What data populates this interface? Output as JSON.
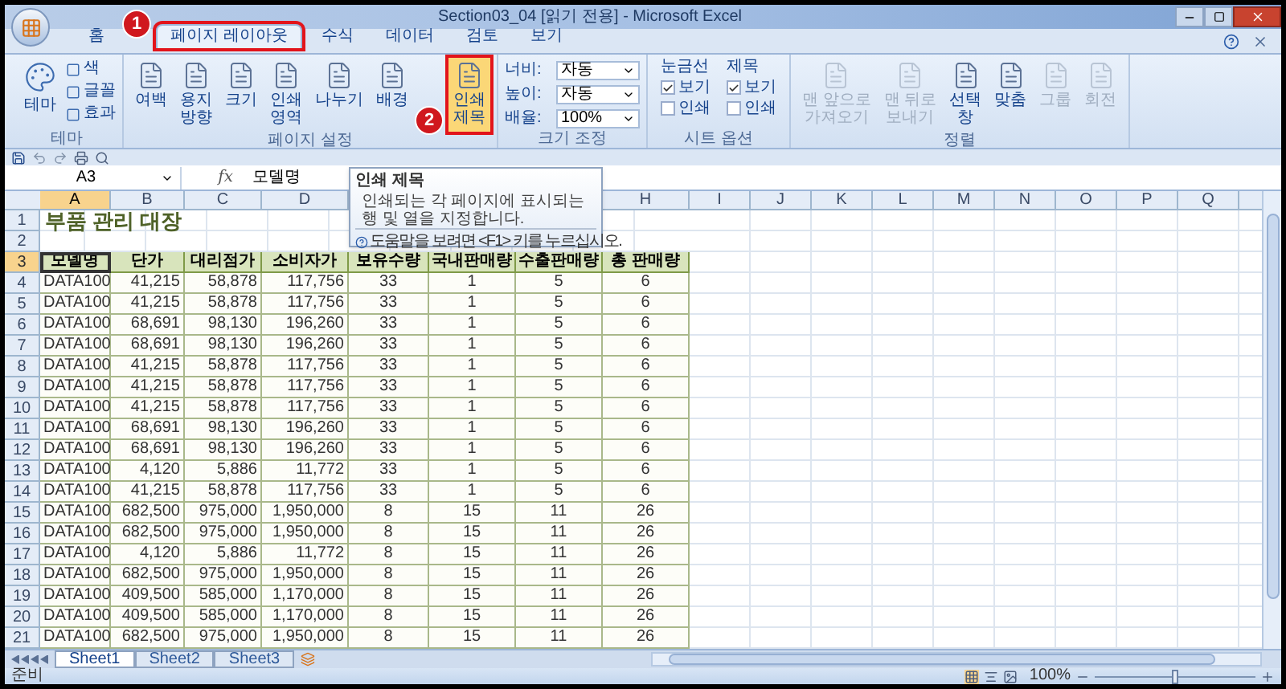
{
  "window": {
    "title": "Section03_04 [읽기 전용] - Microsoft Excel"
  },
  "ribbon_tabs": [
    {
      "label": "홈",
      "selected": false
    },
    {
      "label": "페이지 레이아웃",
      "selected": true,
      "annotation": "1"
    },
    {
      "label": "수식",
      "selected": false
    },
    {
      "label": "데이터",
      "selected": false
    },
    {
      "label": "검토",
      "selected": false
    },
    {
      "label": "보기",
      "selected": false
    }
  ],
  "groups": [
    {
      "label": "테마",
      "items": [
        {
          "kind": "theme",
          "label": "테마"
        },
        {
          "kind": "small",
          "label": "색"
        },
        {
          "kind": "small",
          "label": "글꼴"
        },
        {
          "kind": "small",
          "label": "효과"
        }
      ]
    },
    {
      "label": "페이지 설정",
      "items": [
        {
          "kind": "large",
          "label": "여백",
          "disabled": false
        },
        {
          "kind": "large",
          "label": "용지\n방향",
          "disabled": false
        },
        {
          "kind": "large",
          "label": "크기",
          "disabled": false
        },
        {
          "kind": "large",
          "label": "인쇄\n영역",
          "disabled": false
        },
        {
          "kind": "large",
          "label": "나누기",
          "disabled": false
        },
        {
          "kind": "large",
          "label": "배경",
          "disabled": false
        },
        {
          "kind": "large",
          "label": "인쇄\n제목",
          "disabled": false,
          "highlighted": true,
          "annotation": "2"
        }
      ]
    },
    {
      "label": "크기 조정",
      "items": [
        {
          "kind": "field",
          "label": "너비:",
          "value": "자동"
        },
        {
          "kind": "field",
          "label": "높이:",
          "value": "자동"
        },
        {
          "kind": "field",
          "label": "배율:",
          "value": "100%"
        }
      ]
    },
    {
      "label": "시트 옵션",
      "items": [
        {
          "kind": "checks",
          "label": "눈금선",
          "checks": [
            {
              "label": "보기",
              "checked": true
            },
            {
              "label": "인쇄",
              "checked": false
            }
          ]
        },
        {
          "kind": "checks",
          "label": "제목",
          "checks": [
            {
              "label": "보기",
              "checked": true
            },
            {
              "label": "인쇄",
              "checked": false
            }
          ]
        }
      ]
    },
    {
      "label": "정렬",
      "items": [
        {
          "kind": "large",
          "label": "맨 앞으로\n가져오기",
          "disabled": true
        },
        {
          "kind": "large",
          "label": "맨 뒤로\n보내기",
          "disabled": true
        },
        {
          "kind": "large",
          "label": "선택\n창",
          "disabled": false
        },
        {
          "kind": "large",
          "label": "맞춤",
          "disabled": false
        },
        {
          "kind": "large",
          "label": "그룹",
          "disabled": true
        },
        {
          "kind": "large",
          "label": "회전",
          "disabled": true
        }
      ]
    }
  ],
  "formula_bar": {
    "name_box": "A3",
    "function_label": "fx",
    "value": "모델명"
  },
  "tooltip": {
    "title": "인쇄 제목",
    "description": "인쇄되는 각 페이지에 표시되는 행 및 열을 지정합니다.",
    "help": "도움말을 보려면 <F1> 키를 누르십시오."
  },
  "columns_left": [
    {
      "label": "A",
      "selected": true
    },
    {
      "label": "B",
      "selected": false
    },
    {
      "label": "C",
      "selected": false
    },
    {
      "label": "D",
      "selected": false
    }
  ],
  "columns_right": [
    {
      "label": "H",
      "selected": false
    },
    {
      "label": "I",
      "selected": false
    },
    {
      "label": "J",
      "selected": false
    },
    {
      "label": "K",
      "selected": false
    },
    {
      "label": "L",
      "selected": false
    },
    {
      "label": "M",
      "selected": false
    },
    {
      "label": "N",
      "selected": false
    },
    {
      "label": "O",
      "selected": false
    },
    {
      "label": "P",
      "selected": false
    },
    {
      "label": "Q",
      "selected": false
    }
  ],
  "rows": [
    {
      "num": "1",
      "kind": "title",
      "selected": false,
      "text": "부품 관리 대장"
    },
    {
      "num": "2",
      "kind": "empty",
      "selected": false
    },
    {
      "num": "3",
      "kind": "header",
      "selected": true,
      "cells": [
        {
          "text": "모델명",
          "selected": true
        },
        {
          "text": "단가",
          "selected": false
        },
        {
          "text": "대리점가",
          "selected": false
        },
        {
          "text": "소비자가",
          "selected": false
        },
        {
          "text": "보유수량",
          "selected": false
        },
        {
          "text": "국내판매량",
          "selected": false
        },
        {
          "text": "수출판매량",
          "selected": false
        },
        {
          "text": "총 판매량",
          "selected": false
        }
      ]
    },
    {
      "num": "4",
      "kind": "data",
      "selected": false,
      "cells": [
        "DATA100",
        "41,215",
        "58,878",
        "117,756",
        "33",
        "1",
        "5",
        "6"
      ]
    },
    {
      "num": "5",
      "kind": "data",
      "selected": false,
      "cells": [
        "DATA100",
        "41,215",
        "58,878",
        "117,756",
        "33",
        "1",
        "5",
        "6"
      ]
    },
    {
      "num": "6",
      "kind": "data",
      "selected": false,
      "cells": [
        "DATA100",
        "68,691",
        "98,130",
        "196,260",
        "33",
        "1",
        "5",
        "6"
      ]
    },
    {
      "num": "7",
      "kind": "data",
      "selected": false,
      "cells": [
        "DATA100",
        "68,691",
        "98,130",
        "196,260",
        "33",
        "1",
        "5",
        "6"
      ]
    },
    {
      "num": "8",
      "kind": "data",
      "selected": false,
      "cells": [
        "DATA100",
        "41,215",
        "58,878",
        "117,756",
        "33",
        "1",
        "5",
        "6"
      ]
    },
    {
      "num": "9",
      "kind": "data",
      "selected": false,
      "cells": [
        "DATA100",
        "41,215",
        "58,878",
        "117,756",
        "33",
        "1",
        "5",
        "6"
      ]
    },
    {
      "num": "10",
      "kind": "data",
      "selected": false,
      "cells": [
        "DATA100",
        "41,215",
        "58,878",
        "117,756",
        "33",
        "1",
        "5",
        "6"
      ]
    },
    {
      "num": "11",
      "kind": "data",
      "selected": false,
      "cells": [
        "DATA100",
        "68,691",
        "98,130",
        "196,260",
        "33",
        "1",
        "5",
        "6"
      ]
    },
    {
      "num": "12",
      "kind": "data",
      "selected": false,
      "cells": [
        "DATA100",
        "68,691",
        "98,130",
        "196,260",
        "33",
        "1",
        "5",
        "6"
      ]
    },
    {
      "num": "13",
      "kind": "data",
      "selected": false,
      "cells": [
        "DATA100",
        "4,120",
        "5,886",
        "11,772",
        "33",
        "1",
        "5",
        "6"
      ]
    },
    {
      "num": "14",
      "kind": "data",
      "selected": false,
      "cells": [
        "DATA100",
        "41,215",
        "58,878",
        "117,756",
        "33",
        "1",
        "5",
        "6"
      ]
    },
    {
      "num": "15",
      "kind": "data",
      "selected": false,
      "cells": [
        "DATA100",
        "682,500",
        "975,000",
        "1,950,000",
        "8",
        "15",
        "11",
        "26"
      ]
    },
    {
      "num": "16",
      "kind": "data",
      "selected": false,
      "cells": [
        "DATA100",
        "682,500",
        "975,000",
        "1,950,000",
        "8",
        "15",
        "11",
        "26"
      ]
    },
    {
      "num": "17",
      "kind": "data",
      "selected": false,
      "cells": [
        "DATA100",
        "4,120",
        "5,886",
        "11,772",
        "8",
        "15",
        "11",
        "26"
      ]
    },
    {
      "num": "18",
      "kind": "data",
      "selected": false,
      "cells": [
        "DATA100",
        "682,500",
        "975,000",
        "1,950,000",
        "8",
        "15",
        "11",
        "26"
      ]
    },
    {
      "num": "19",
      "kind": "data",
      "selected": false,
      "cells": [
        "DATA100",
        "409,500",
        "585,000",
        "1,170,000",
        "8",
        "15",
        "11",
        "26"
      ]
    },
    {
      "num": "20",
      "kind": "data",
      "selected": false,
      "cells": [
        "DATA100",
        "409,500",
        "585,000",
        "1,170,000",
        "8",
        "15",
        "11",
        "26"
      ]
    },
    {
      "num": "21",
      "kind": "data",
      "selected": false,
      "cells": [
        "DATA100",
        "682,500",
        "975,000",
        "1,950,000",
        "8",
        "15",
        "11",
        "26"
      ]
    }
  ],
  "sheet_tabs": [
    {
      "label": "Sheet1",
      "selected": true
    },
    {
      "label": "Sheet2",
      "selected": false
    },
    {
      "label": "Sheet3",
      "selected": false
    }
  ],
  "status_bar": {
    "text": "준비",
    "zoom": {
      "label": "100%",
      "level": 0.5
    }
  }
}
